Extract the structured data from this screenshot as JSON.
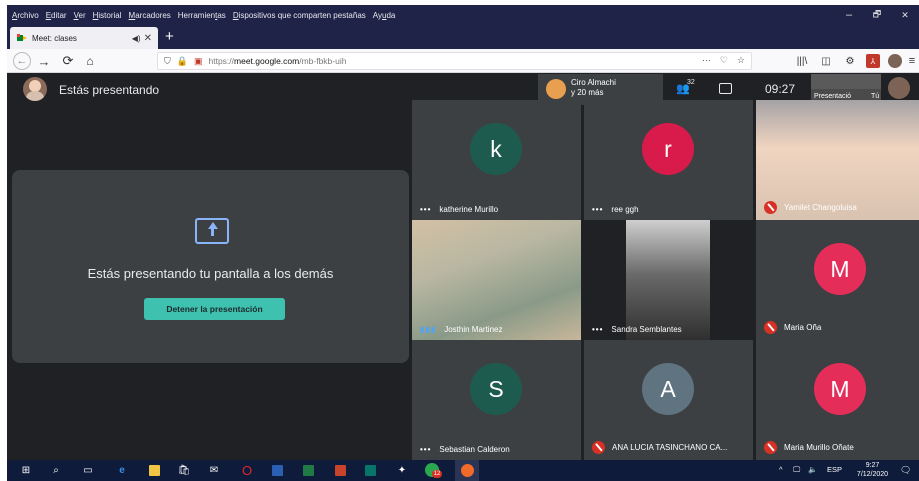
{
  "browser": {
    "menu": [
      {
        "pre": "",
        "u": "A",
        "post": "rchivo"
      },
      {
        "pre": "",
        "u": "E",
        "post": "ditar"
      },
      {
        "pre": "",
        "u": "V",
        "post": "er"
      },
      {
        "pre": "",
        "u": "H",
        "post": "istorial"
      },
      {
        "pre": "",
        "u": "M",
        "post": "arcadores"
      },
      {
        "pre": "Herramien",
        "u": "t",
        "post": "as"
      },
      {
        "pre": "",
        "u": "D",
        "post": "ispositivos que comparten pestañas"
      },
      {
        "pre": "Ay",
        "u": "u",
        "post": "da"
      }
    ],
    "window_controls": [
      "–",
      "🗗",
      "✕"
    ],
    "tab": {
      "title": "Meet: clases",
      "audio_icon": "◀)",
      "close": "✕"
    },
    "new_tab": "+",
    "nav": {
      "back": "←",
      "forward": "→",
      "reload": "⟳",
      "home": "⌂"
    },
    "url_prefix": "https://",
    "url_host": "meet.google.com",
    "url_path": "/mb-fbkb-uih",
    "url_actions": [
      "···",
      "♡",
      "☆"
    ],
    "toolbar_icons": [
      "library-icon",
      "sidebar-icon",
      "extensions-icon",
      "pdf-icon",
      "profile-icon",
      "menu-icon"
    ]
  },
  "meet": {
    "header_title": "Estás presentando",
    "presenter_name": "Ciro Almachi",
    "presenter_more": "y 20 más",
    "people_count": "32",
    "clock": "09:27",
    "self_tile_label": "Presentació",
    "you_label": "Tú",
    "present_message": "Estás presentando tu pantalla a los demás",
    "stop_button": "Detener la presentación",
    "participants": [
      {
        "name": "katherine Murillo",
        "letter": "k",
        "color": "#1e5b4f",
        "status": "dots",
        "video": false
      },
      {
        "name": "ree ggh",
        "letter": "r",
        "color": "#d81b4b",
        "status": "dots",
        "video": false
      },
      {
        "name": "Yamilet Changoluisa",
        "letter": "",
        "color": "",
        "status": "muted",
        "video": true
      },
      {
        "name": "Josthin Martinez",
        "letter": "",
        "color": "",
        "status": "speaking",
        "video": true
      },
      {
        "name": "Sandra Semblantes",
        "letter": "",
        "color": "",
        "status": "dots",
        "video": true
      },
      {
        "name": "Maria Oña",
        "letter": "M",
        "color": "#e52d5a",
        "status": "muted",
        "video": false
      },
      {
        "name": "Sebastian Calderon",
        "letter": "S",
        "color": "#1e5b4f",
        "status": "dots",
        "video": false
      },
      {
        "name": "ANA LUCIA TASINCHANO CA...",
        "letter": "A",
        "color": "#5f7480",
        "status": "muted",
        "video": false
      },
      {
        "name": "Maria Murillo Oñate",
        "letter": "M",
        "color": "#e52d5a",
        "status": "muted",
        "video": false
      }
    ]
  },
  "taskbar": {
    "tray_text": "ESP",
    "time": "9:27",
    "date": "7/12/2020",
    "notifications_badge": "12"
  }
}
